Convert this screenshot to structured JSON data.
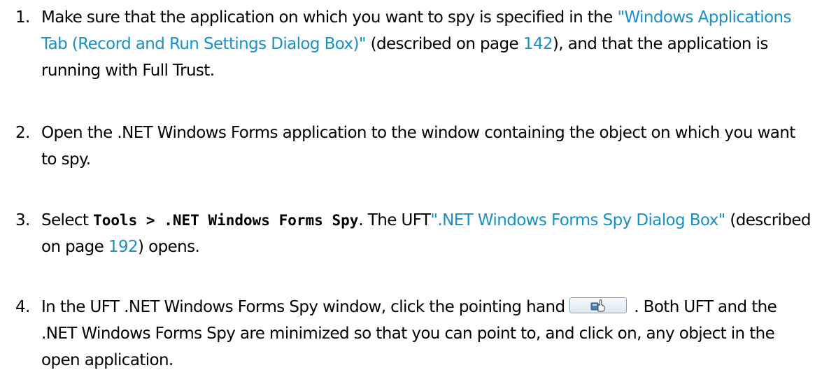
{
  "steps": [
    {
      "number": "1.",
      "text_a": "Make sure that the application on which you want to spy is specified in the ",
      "link": "\"Windows Applications Tab (Record and Run Settings Dialog Box)\"",
      "text_b": " (described on page ",
      "page": "142",
      "text_c": "), and that the application is running with Full Trust."
    },
    {
      "number": "2.",
      "text": "Open the .NET Windows Forms application to the window containing the object on which you want to spy."
    },
    {
      "number": "3.",
      "text_a": "Select ",
      "menu_path": "Tools > .NET Windows Forms Spy",
      "text_b": ". The UFT",
      "link": "\".NET Windows Forms Spy Dialog Box\"",
      "text_c": " (described on page ",
      "page": "192",
      "text_d": ") opens."
    },
    {
      "number": "4.",
      "text_a": "In the UFT .NET Windows Forms Spy window, click the pointing hand",
      "button_icon": "pointing-hand-icon",
      "text_b": " . Both UFT and the .NET Windows Forms Spy are minimized so that you can point to, and click on, any object in the open application."
    }
  ],
  "colors": {
    "link": "#1890c8",
    "text": "#000000"
  }
}
